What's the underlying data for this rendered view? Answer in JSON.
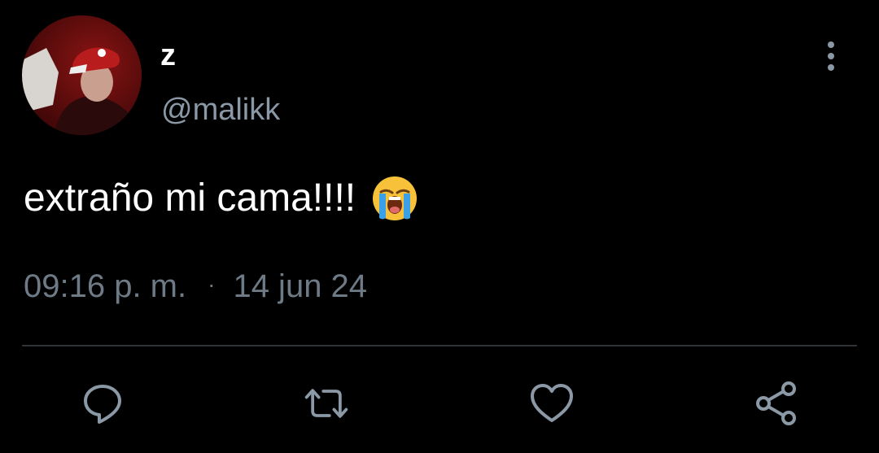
{
  "tweet": {
    "display_name": "z",
    "handle": "@malikk",
    "text": "extraño mi cama!!!!",
    "emoji": "loudly-crying-face",
    "time": "09:16 p. m.",
    "separator": "·",
    "date": "14 jun 24"
  },
  "actions": [
    {
      "name": "reply",
      "icon": "comment-icon"
    },
    {
      "name": "retweet",
      "icon": "retweet-icon"
    },
    {
      "name": "like",
      "icon": "heart-icon"
    },
    {
      "name": "share",
      "icon": "share-icon"
    }
  ],
  "colors": {
    "background": "#000000",
    "primary_text": "#ffffff",
    "secondary_text": "#8b98a5",
    "meta_text": "#6e7b87",
    "icon": "#8b98a5",
    "divider": "#2f3336"
  }
}
